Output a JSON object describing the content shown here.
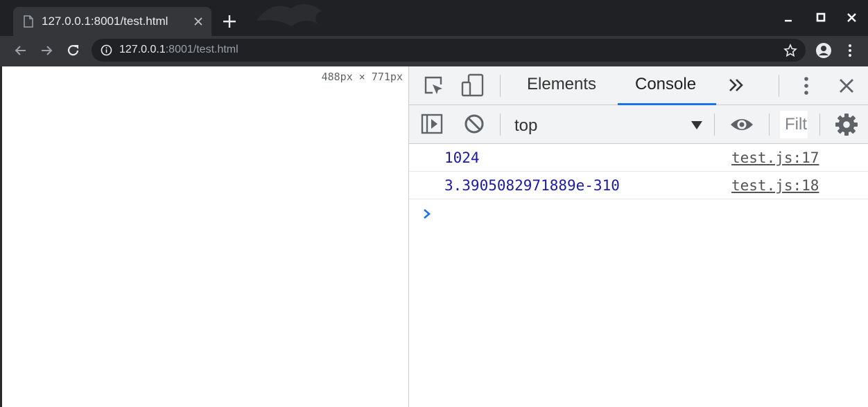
{
  "browser": {
    "tab": {
      "title": "127.0.0.1:8001/test.html"
    },
    "address": {
      "host": "127.0.0.1",
      "rest": ":8001/test.html"
    }
  },
  "page": {
    "dimensions_overlay": "488px × 771px"
  },
  "devtools": {
    "tabs": [
      {
        "label": "Elements",
        "active": false
      },
      {
        "label": "Console",
        "active": true
      }
    ],
    "context": {
      "selected": "top"
    },
    "filter": {
      "placeholder": "Filter",
      "value": ""
    },
    "console_messages": [
      {
        "value": "1024",
        "source": "test.js:17"
      },
      {
        "value": "3.3905082971889e-310",
        "source": "test.js:18"
      }
    ]
  },
  "colors": {
    "chrome_dark": "#202124",
    "chrome_toolbar": "#35363a",
    "devtools_bg": "#f1f3f4",
    "active_tab_underline": "#1a73e8",
    "console_number": "#1a1aa6",
    "prompt_chevron": "#1a73e8"
  },
  "icons": [
    "page-icon",
    "close-icon",
    "plus-icon",
    "minimize-icon",
    "maximize-icon",
    "window-close-icon",
    "back-arrow-icon",
    "forward-arrow-icon",
    "reload-icon",
    "info-icon",
    "star-icon",
    "account-icon",
    "kebab-menu-icon",
    "inspect-element-icon",
    "device-toolbar-icon",
    "more-tabs-icon",
    "sidebar-toggle-icon",
    "clear-console-icon",
    "dropdown-arrow-icon",
    "eye-icon",
    "gear-icon",
    "prompt-chevron-icon"
  ]
}
